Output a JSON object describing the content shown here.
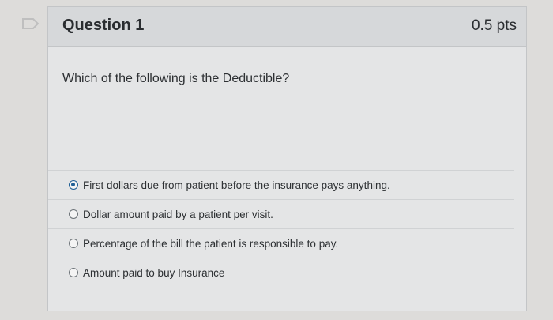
{
  "question": {
    "title": "Question 1",
    "points": "0.5 pts",
    "text": "Which of the following is the Deductible?"
  },
  "answers": [
    {
      "label": "First dollars due from patient before the insurance pays anything.",
      "selected": true
    },
    {
      "label": "Dollar amount paid by a patient per visit.",
      "selected": false
    },
    {
      "label": "Percentage of the bill the patient is responsible to pay.",
      "selected": false
    },
    {
      "label": "Amount paid to buy Insurance",
      "selected": false
    }
  ],
  "colors": {
    "accent": "#1f5f96",
    "flag": "#bfbfbf"
  },
  "icons": {
    "flag": "flag-icon"
  }
}
